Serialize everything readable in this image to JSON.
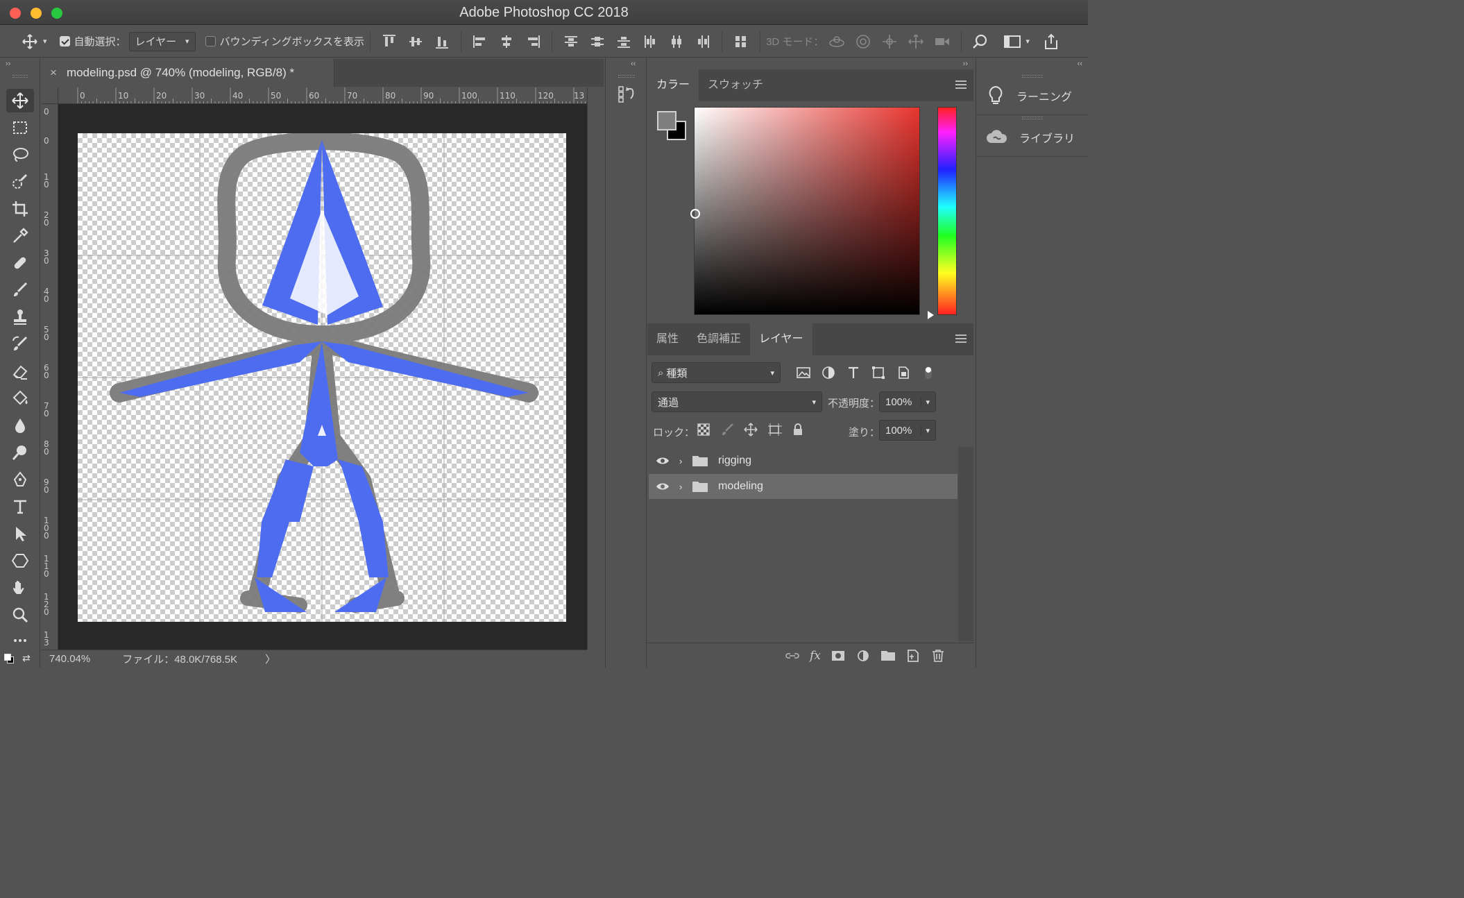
{
  "window": {
    "title": "Adobe Photoshop CC 2018"
  },
  "options_bar": {
    "auto_select_label": "自動選択：",
    "auto_select_target": "レイヤー",
    "bounding_box_label": "バウンディングボックスを表示",
    "mode_3d_label": "3D モード："
  },
  "document": {
    "tab_title": "modeling.psd @ 740% (modeling, RGB/8) *",
    "close_glyph": "×"
  },
  "ruler": {
    "h_ticks": [
      "0",
      "10",
      "20",
      "30",
      "40",
      "50",
      "60",
      "70",
      "80",
      "90",
      "100",
      "110",
      "120",
      "13"
    ],
    "v_ticks": [
      "0",
      "0",
      "1 0",
      "2 0",
      "3 0",
      "4 0",
      "5 0",
      "6 0",
      "7 0",
      "8 0",
      "9 0",
      "1 0 0",
      "1 1 0",
      "1 2 0",
      "1 3"
    ]
  },
  "status": {
    "zoom": "740.04%",
    "file_info": "ファイル：48.0K/768.5K",
    "arrow": "〉"
  },
  "color_panel": {
    "tabs": [
      "カラー",
      "スウォッチ"
    ],
    "active_tab": 0,
    "foreground": "#7f7f7f",
    "background": "#000000"
  },
  "layers_panel": {
    "tabs": [
      "属性",
      "色調補正",
      "レイヤー"
    ],
    "active_tab": 2,
    "filter_label": "種類",
    "blend_mode": "通過",
    "opacity_label": "不透明度：",
    "opacity_value": "100%",
    "lock_label": "ロック：",
    "fill_label": "塗り：",
    "fill_value": "100%",
    "layers": [
      {
        "name": "rigging",
        "visible": true,
        "selected": false
      },
      {
        "name": "modeling",
        "visible": true,
        "selected": true
      }
    ]
  },
  "right_panel": {
    "items": [
      {
        "label": "ラーニング",
        "icon": "lightbulb-icon"
      },
      {
        "label": "ライブラリ",
        "icon": "cc-libraries-icon"
      }
    ]
  },
  "colors": {
    "figure_blue": "#4e6cf0",
    "figure_gray": "#7d7d7d",
    "ui_bg": "#535353"
  }
}
